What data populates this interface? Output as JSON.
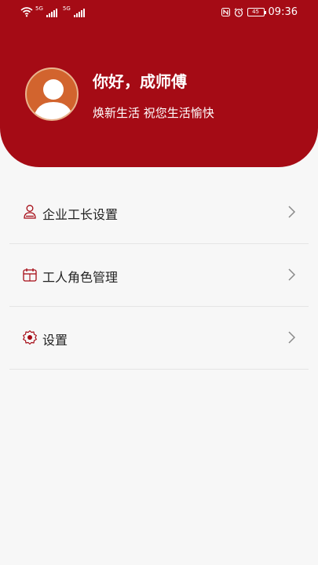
{
  "status_bar": {
    "sim1_label": "5G",
    "sim2_label": "5G",
    "battery": "45",
    "time": "09:36",
    "icons": [
      "wifi-icon",
      "signal-icon",
      "nfc-icon",
      "alarm-icon",
      "battery-icon"
    ]
  },
  "profile": {
    "greeting": "你好，成师傅",
    "slogan": "焕新生活 祝您生活愉快",
    "avatar_icon": "default-user-avatar"
  },
  "menu": {
    "items": [
      {
        "label": "企业工长设置",
        "icon": "foreman-user-icon"
      },
      {
        "label": "工人角色管理",
        "icon": "calendar-role-icon"
      },
      {
        "label": "设置",
        "icon": "gear-icon"
      }
    ]
  },
  "colors": {
    "header_bg": "#a50b15",
    "accent": "#a50b15",
    "page_bg": "#f7f7f7",
    "avatar_bg": "#d2642e"
  }
}
